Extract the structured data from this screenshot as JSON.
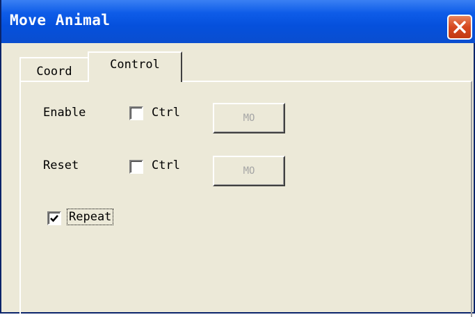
{
  "window": {
    "title": "Move Animal",
    "close_icon": "close-icon"
  },
  "tabs": [
    {
      "label": "Coord",
      "active": false
    },
    {
      "label": "Control",
      "active": true
    }
  ],
  "controls": {
    "enable": {
      "label": "Enable",
      "checkbox_label": "Ctrl",
      "checked": false,
      "button_label": "MO"
    },
    "reset": {
      "label": "Reset",
      "checkbox_label": "Ctrl",
      "checked": false,
      "button_label": "MO"
    },
    "repeat": {
      "label": "Repeat",
      "checked": true
    }
  },
  "colors": {
    "titlebar": "#0550DC",
    "face": "#ECE9D8",
    "close": "#D6481F",
    "disabled_text": "#A5A5A5"
  }
}
